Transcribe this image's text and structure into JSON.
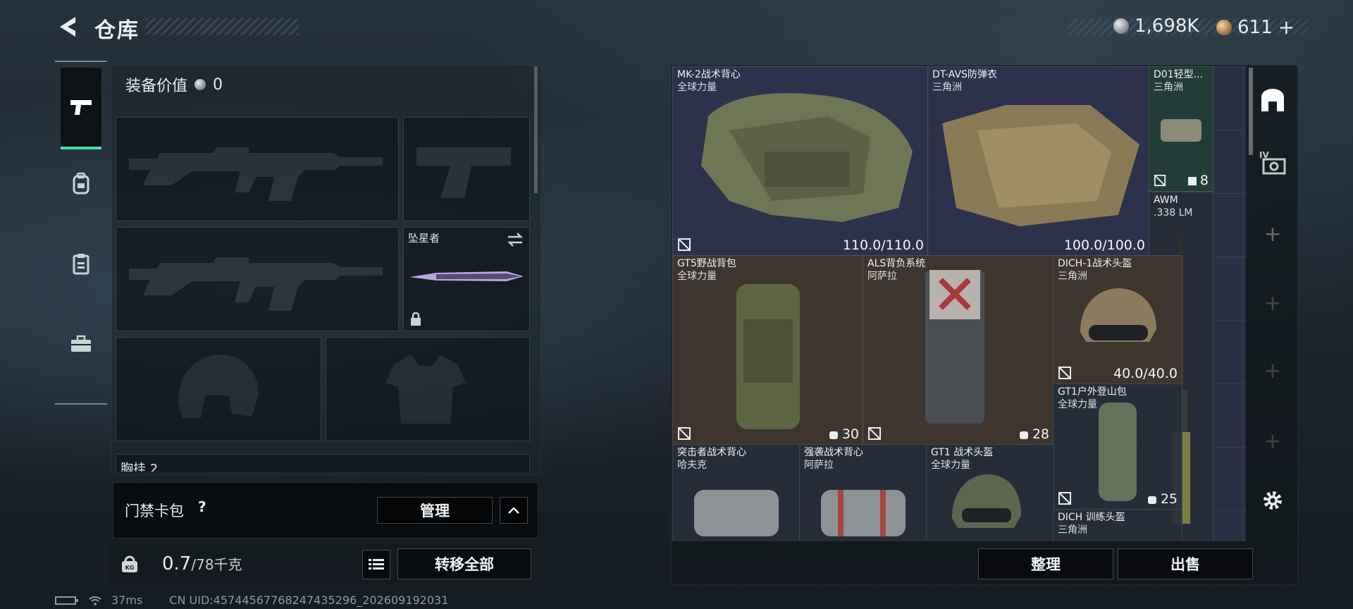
{
  "header": {
    "title": "仓库"
  },
  "currency": {
    "silver": {
      "amount": "1,698K",
      "icon": "silver-coin-icon"
    },
    "gold": {
      "amount": "611",
      "icon": "gold-coin-icon",
      "add": "+"
    }
  },
  "nav": {
    "items": [
      {
        "icon": "pistol-icon"
      },
      {
        "icon": "backpack-icon"
      },
      {
        "icon": "clipboard-icon"
      },
      {
        "icon": "toolbox-icon"
      }
    ]
  },
  "loadout": {
    "equip_value_label": "装备价值",
    "equip_value": "0",
    "melee_name": "坠星者",
    "chest_rig_label": "胸挂 2"
  },
  "keycard": {
    "label": "门禁卡包",
    "help": "?",
    "manage": "管理"
  },
  "weight": {
    "current": "0.7",
    "max": "/78千克",
    "transfer_all": "转移全部"
  },
  "stash": {
    "items": [
      {
        "name": "MK-2战术背心",
        "faction": "全球力量",
        "durability": "110.0/110.0"
      },
      {
        "name": "DT-AVS防弹衣",
        "faction": "三角洲",
        "durability": "100.0/100.0"
      },
      {
        "name": "D01轻型...",
        "faction": "三角洲",
        "count": "8"
      },
      {
        "name": "AWM",
        "faction": ".338 LM"
      },
      {
        "name": "GT5野战背包",
        "faction": "全球力量",
        "count": "30"
      },
      {
        "name": "ALS背负系统",
        "faction": "阿萨拉",
        "count": "28"
      },
      {
        "name": "DICH-1战术头盔",
        "faction": "三角洲",
        "durability": "40.0/40.0"
      },
      {
        "name": "GT1户外登山包",
        "faction": "全球力量",
        "count": "25"
      },
      {
        "name": "突击者战术背心",
        "faction": "哈夫克"
      },
      {
        "name": "强袭战术背心",
        "faction": "阿萨拉"
      },
      {
        "name": "GT1 战术头盔",
        "faction": "全球力量"
      },
      {
        "name": "DICH 训练头盔",
        "faction": "三角洲"
      }
    ],
    "sort": "整理",
    "sell": "出售"
  },
  "status": {
    "ping": "37ms",
    "uid": "CN UID:457445677682474352​96_202609192031"
  }
}
